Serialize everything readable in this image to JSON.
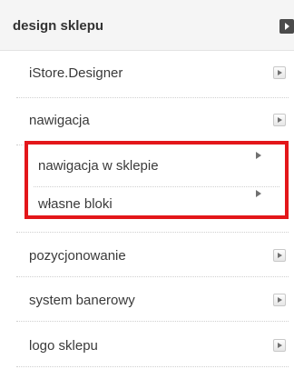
{
  "header": {
    "title": "design sklepu"
  },
  "menu": {
    "items": [
      {
        "label": "iStore.Designer"
      },
      {
        "label": "nawigacja"
      },
      {
        "label": "pozycjonowanie"
      },
      {
        "label": "system banerowy"
      },
      {
        "label": "logo sklepu"
      }
    ],
    "submenu": [
      {
        "label": "nawigacja w sklepie"
      },
      {
        "label": "własne bloki"
      }
    ]
  },
  "colors": {
    "highlight": "#e3161a"
  }
}
